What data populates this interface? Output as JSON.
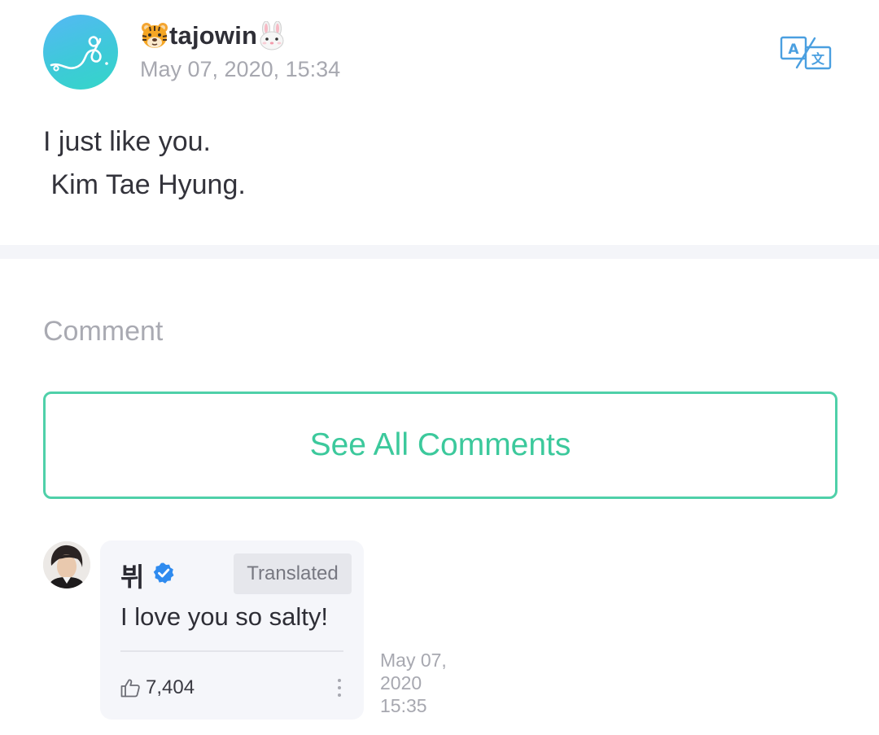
{
  "post": {
    "author": "tajowin",
    "author_emoji_left": "tiger-face",
    "author_emoji_right": "rabbit-face",
    "date": "May 07, 2020, 15:34",
    "body": "I just like you.\n Kim Tae Hyung.",
    "translate_icon": "translate-icon"
  },
  "comments_section": {
    "heading": "Comment",
    "see_all_label": "See All Comments"
  },
  "comment": {
    "author": "뷔",
    "verified": true,
    "badge": "Translated",
    "text": "I love you so salty!",
    "likes": "7,404",
    "date_line1": "May 07,",
    "date_line2": "2020",
    "date_line3": "15:35"
  },
  "colors": {
    "accent": "#3cc99c",
    "accent_border": "#4fd0a9",
    "muted_text": "#a7a8b0",
    "verified_blue": "#2f8bef",
    "translate_icon": "#4a9fe0",
    "bubble_bg": "#f5f6fa",
    "band_bg": "#f4f5f9"
  }
}
